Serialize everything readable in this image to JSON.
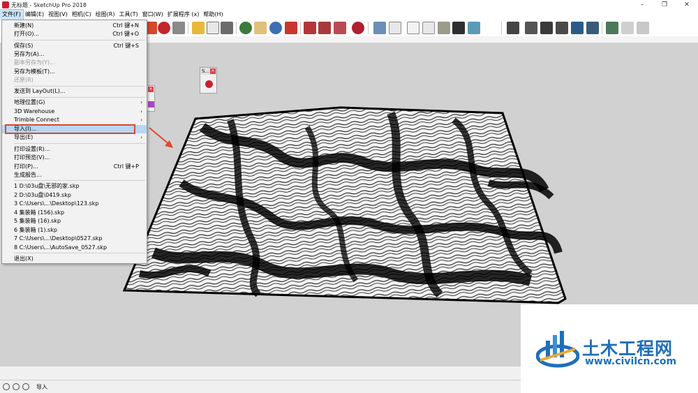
{
  "window": {
    "title": "无标题 - SketchUp Pro 2018",
    "minimize": "–",
    "maximize": "❐",
    "close": "✕"
  },
  "menubar": [
    "文件(F)",
    "编辑(E)",
    "视图(V)",
    "相机(C)",
    "绘图(R)",
    "工具(T)",
    "窗口(W)",
    "扩展程序 (x)",
    "帮助(H)"
  ],
  "file_menu": {
    "new": {
      "label": "新建(N)",
      "shortcut": "Ctrl 键+N"
    },
    "open": {
      "label": "打开(O)...",
      "shortcut": "Ctrl 键+O"
    },
    "save": {
      "label": "保存(S)",
      "shortcut": "Ctrl 键+S"
    },
    "save_as": {
      "label": "另存为(A)..."
    },
    "save_copy_as": {
      "label": "副本另存为(Y)..."
    },
    "save_as_template": {
      "label": "另存为模板(T)..."
    },
    "revert": {
      "label": "还原(R)"
    },
    "send_to_layout": {
      "label": "发送到 LayOut(L)..."
    },
    "geo_location": {
      "label": "地理位置(G)"
    },
    "warehouse": {
      "label": "3D Warehouse"
    },
    "trimble": {
      "label": "Trimble Connect"
    },
    "import": {
      "label": "导入(I)..."
    },
    "export": {
      "label": "导出(E)"
    },
    "print_setup": {
      "label": "打印设置(R)..."
    },
    "print_preview": {
      "label": "打印预览(V)..."
    },
    "print": {
      "label": "打印(P)...",
      "shortcut": "Ctrl 键+P"
    },
    "report": {
      "label": "生成报告..."
    },
    "recent": [
      "1 D:\\03u盘\\无邪的家.skp",
      "2 D:\\03u盘\\0419.skp",
      "3 C:\\Users\\...\\Desktop\\123.skp",
      "4 集装箱 (156).skp",
      "5 集装箱 (16).skp",
      "6 集装箱 (1).skp",
      "7 C:\\Users\\...\\Desktop\\0527.skp",
      "8 C:\\Users\\...\\AutoSave_0527.skp"
    ],
    "exit": {
      "label": "退出(X)"
    }
  },
  "panels": {
    "mini_title": "S...",
    "close_glyph": "×"
  },
  "status": {
    "text": "导入"
  },
  "watermark": {
    "name": "土木工程网",
    "url": "www.civilcn.com"
  },
  "colors": {
    "highlight_box": "#e0452f",
    "selection": "#b7d7f2",
    "viewport_bg": "#d1d1d1",
    "watermark_blue": "#1f6fba"
  }
}
